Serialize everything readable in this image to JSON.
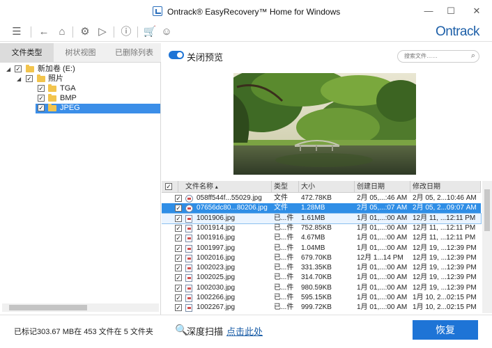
{
  "window": {
    "title": "Ontrack® EasyRecovery™ Home for Windows",
    "controls": {
      "minimize": "—",
      "maximize": "☐",
      "close": "✕"
    }
  },
  "toolbar": {
    "icons": [
      "menu-icon",
      "back-icon",
      "home-icon",
      "settings-icon",
      "play-icon",
      "info-icon",
      "cart-icon",
      "user-icon"
    ],
    "logo": "Ontrack"
  },
  "left_panel": {
    "tabs": [
      {
        "label": "文件类型",
        "active": true
      },
      {
        "label": "树状视图",
        "active": false
      },
      {
        "label": "已删除列表",
        "active": false
      }
    ],
    "tree": [
      {
        "label": "新加卷 (E:)",
        "checked": true,
        "expanded": true
      },
      {
        "label": "照片",
        "checked": true,
        "expanded": true
      },
      {
        "label": "TGA",
        "checked": true
      },
      {
        "label": "BMP",
        "checked": true
      },
      {
        "label": "JPEG",
        "checked": true,
        "selected": true
      }
    ]
  },
  "preview": {
    "toggle_label": "关闭预览",
    "toggle_on": true,
    "search_placeholder": "搜索文件……"
  },
  "table": {
    "headers": [
      "文件名称",
      "类型",
      "大小",
      "创建日期",
      "修改日期"
    ],
    "rows": [
      {
        "name": "058ff544f...55029.jpg",
        "type": "文件",
        "size": "472.78KB",
        "created": "2月 05,...:46 AM",
        "modified": "2月 05, 2...10:46 AM"
      },
      {
        "name": "07656dc80...80206.jpg",
        "type": "文件",
        "size": "1.28MB",
        "created": "2月 05,...:07 AM",
        "modified": "2月 05, 2...09:07 AM"
      },
      {
        "name": "1001906.jpg",
        "type": "已...件",
        "size": "1.61MB",
        "created": "1月 01,...:00 AM",
        "modified": "12月 11, ...12:11 PM"
      },
      {
        "name": "1001914.jpg",
        "type": "已...件",
        "size": "752.85KB",
        "created": "1月 01,...:00 AM",
        "modified": "12月 11, ...12:11 PM"
      },
      {
        "name": "1001916.jpg",
        "type": "已...件",
        "size": "4.67MB",
        "created": "1月 01,...:00 AM",
        "modified": "12月 11, ...12:11 PM"
      },
      {
        "name": "1001997.jpg",
        "type": "已...件",
        "size": "1.04MB",
        "created": "1月 01,...:00 AM",
        "modified": "12月 19, ...12:39 PM"
      },
      {
        "name": "1002016.jpg",
        "type": "已...件",
        "size": "679.70KB",
        "created": "12月 1...14 PM",
        "modified": "12月 19, ...12:39 PM"
      },
      {
        "name": "1002023.jpg",
        "type": "已...件",
        "size": "331.35KB",
        "created": "1月 01,...:00 AM",
        "modified": "12月 19, ...12:39 PM"
      },
      {
        "name": "1002025.jpg",
        "type": "已...件",
        "size": "314.70KB",
        "created": "1月 01,...:00 AM",
        "modified": "12月 19, ...12:39 PM"
      },
      {
        "name": "1002030.jpg",
        "type": "已...件",
        "size": "980.59KB",
        "created": "1月 01,...:00 AM",
        "modified": "12月 19, ...12:39 PM"
      },
      {
        "name": "1002266.jpg",
        "type": "已...件",
        "size": "595.15KB",
        "created": "1月 01,...:00 AM",
        "modified": "1月 10, 2...02:15 PM"
      },
      {
        "name": "1002267.jpg",
        "type": "已...件",
        "size": "999.72KB",
        "created": "1月 01,...:00 AM",
        "modified": "1月 10, 2...02:15 PM"
      }
    ]
  },
  "status": {
    "summary": "已标记303.67 MB在 453 文件在 5 文件夹",
    "deep_scan_label": "深度扫描",
    "deep_scan_link": "点击此处",
    "recover_button": "恢复"
  },
  "colors": {
    "accent": "#1e74d6",
    "selection": "#2f8ee6",
    "folder": "#f2c44d",
    "logo": "#1d5fa8"
  }
}
